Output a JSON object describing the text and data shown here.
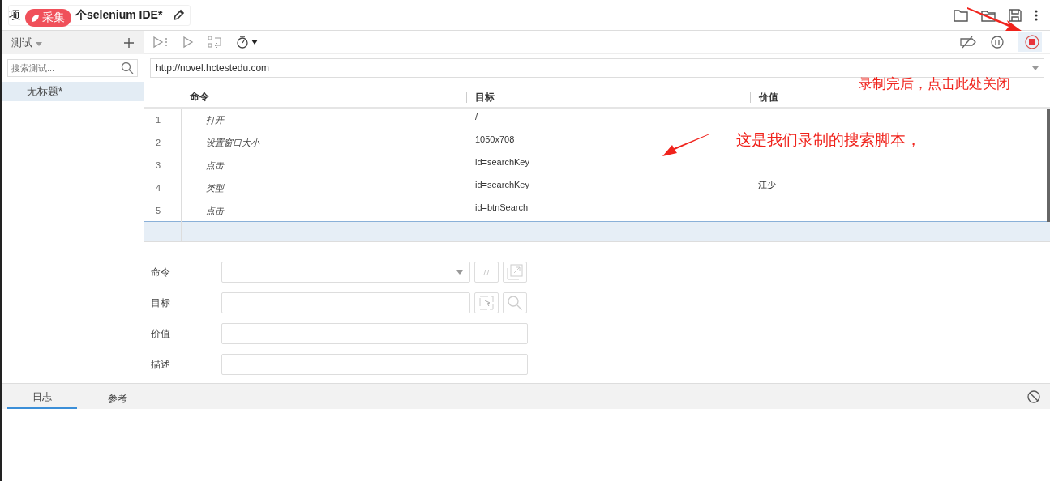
{
  "window": {
    "title_start": "项",
    "title_end": "个selenium IDE*",
    "badge": "采集"
  },
  "sidebar": {
    "header": "测试",
    "search": {
      "placeholder": "搜索测试..."
    },
    "items": [
      {
        "label": "无标题*",
        "selected": true
      }
    ]
  },
  "toolbar": {
    "recording": true
  },
  "url": {
    "value": "http://novel.hctestedu.com"
  },
  "table": {
    "columns": [
      "命令",
      "目标",
      "价值"
    ],
    "rows": [
      {
        "index": "1",
        "command": "打开",
        "target": "/",
        "value": "",
        "selected": false
      },
      {
        "index": "2",
        "command": "设置窗口大小",
        "target": "1050x708",
        "value": "",
        "selected": false
      },
      {
        "index": "3",
        "command": "点击",
        "target": "id=searchKey",
        "value": "",
        "selected": false
      },
      {
        "index": "4",
        "command": "类型",
        "target": "id=searchKey",
        "value": "江少",
        "selected": false
      },
      {
        "index": "5",
        "command": "点击",
        "target": "id=btnSearch",
        "value": "",
        "selected": false
      }
    ],
    "new_row": {
      "selected": true
    }
  },
  "editor": {
    "labels": [
      "命令",
      "目标",
      "价值",
      "描述"
    ]
  },
  "bottom_tabs": [
    {
      "label": "日志",
      "selected": true
    },
    {
      "label": "参考",
      "selected": false
    }
  ],
  "annotations": [
    "录制完后，点击此处关闭",
    "这是我们录制的搜索脚本，"
  ]
}
